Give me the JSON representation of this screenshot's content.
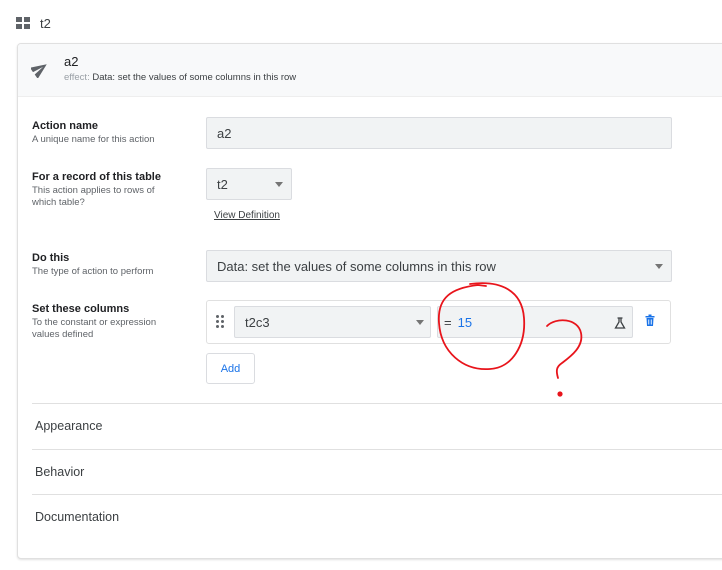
{
  "app": {
    "table_name": "t2"
  },
  "header": {
    "title": "a2",
    "effect_label": "effect:",
    "effect_value": "Data: set the values of some columns in this row"
  },
  "action_name": {
    "label": "Action name",
    "help": "A unique name for this action",
    "value": "a2"
  },
  "for_record": {
    "label": "For a record of this table",
    "help": "This action applies to rows of which table?",
    "value": "t2",
    "link": "View Definition"
  },
  "do_this": {
    "label": "Do this",
    "help": "The type of action to perform",
    "value": "Data: set the values of some columns in this row"
  },
  "set_columns": {
    "label": "Set these columns",
    "help": "To the constant or expression values defined",
    "column": "t2c3",
    "operator": "=",
    "expression": "15",
    "add_label": "Add"
  },
  "sections": [
    "Appearance",
    "Behavior",
    "Documentation"
  ],
  "colors": {
    "accent": "#1a73e8",
    "annotation": "#e8141b"
  },
  "icons": [
    "grid-icon",
    "paper-plane-icon",
    "drag-handle-icon",
    "flask-icon",
    "trash-icon",
    "dropdown-caret-icon"
  ]
}
